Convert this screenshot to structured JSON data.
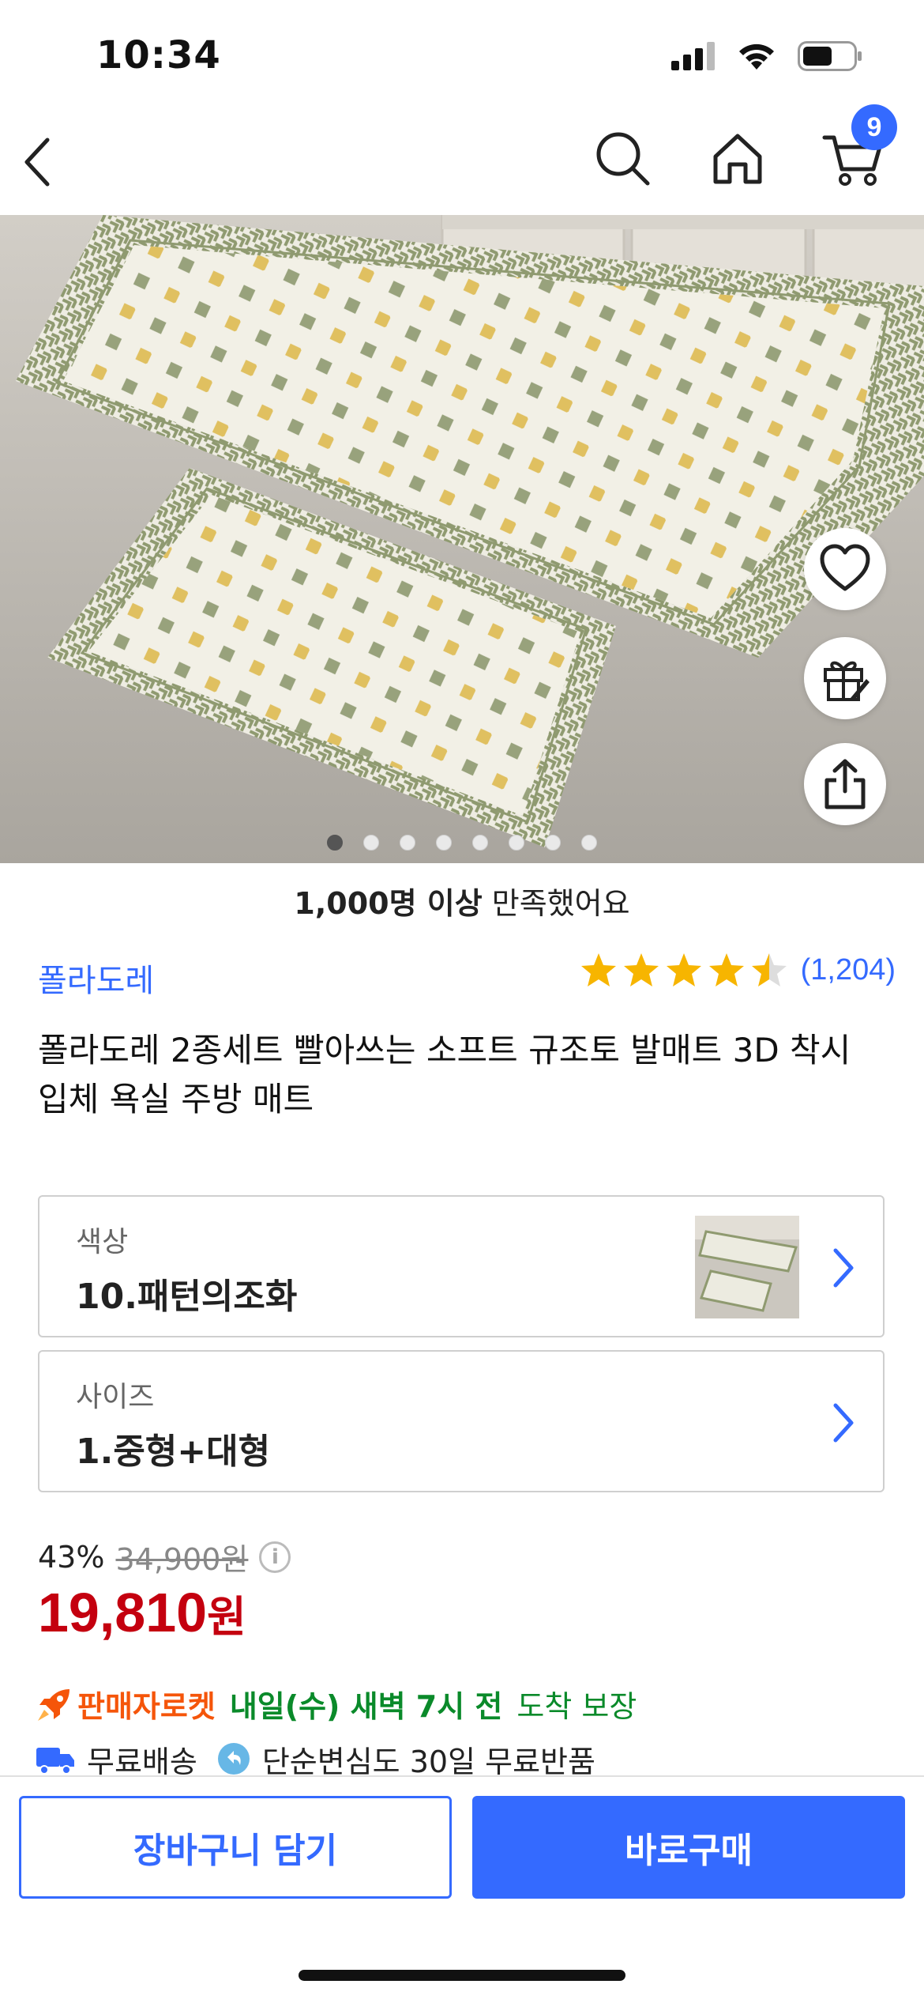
{
  "status_bar": {
    "time": "10:34"
  },
  "nav": {
    "cart_count": "9"
  },
  "hero": {
    "page_count": 8,
    "active_page": 0
  },
  "satisfaction": {
    "bold": "1,000명 이상",
    "rest": " 만족했어요"
  },
  "brand": "폴라도레",
  "rating": {
    "stars": 4.5,
    "count": "(1,204)"
  },
  "product_title": "폴라도레 2종세트 빨아쓰는 소프트 규조토 발매트 3D 착시 입체 욕실 주방 매트",
  "options": [
    {
      "label": "색상",
      "value": "10.패턴의조화"
    },
    {
      "label": "사이즈",
      "value": "1.중형+대형"
    }
  ],
  "price": {
    "discount": "43%",
    "original": "34,900원",
    "sale_number": "19,810",
    "sale_unit": "원"
  },
  "delivery": {
    "badge": "판매자로켓",
    "highlight": "내일(수) 새벽 7시 전",
    "suffix": "도착 보장"
  },
  "shipping": {
    "free_shipping": "무료배송",
    "return_policy": "단순변심도 30일 무료반품"
  },
  "actions": {
    "cart": "장바구니 담기",
    "buy": "바로구매"
  },
  "colors": {
    "accent": "#346AFF",
    "price": "#c4000f",
    "rocket": "#f5550a",
    "delivery": "#0a8a2a",
    "star": "#f7b500"
  }
}
